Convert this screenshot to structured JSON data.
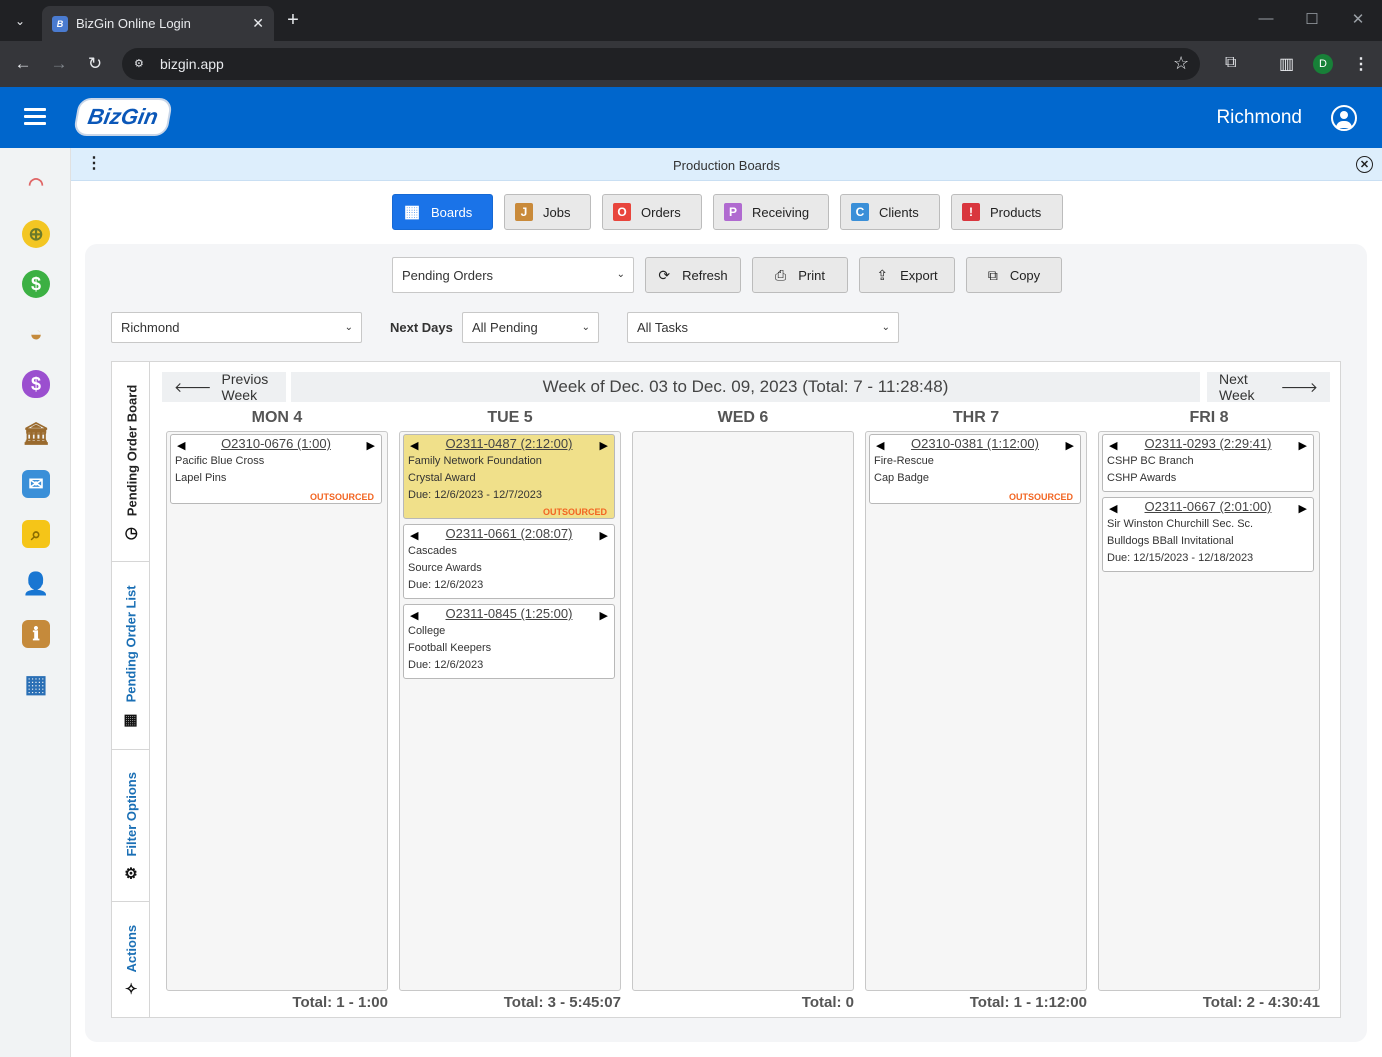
{
  "browser": {
    "tab_title": "BizGin Online Login",
    "favicon_label": "B",
    "tab_close": "✕",
    "new_tab": "+",
    "url": "bizgin.app",
    "profile_initial": "D"
  },
  "app": {
    "logo_text": "BizGin",
    "user_name": "Richmond",
    "banner_title": "Production Boards"
  },
  "sidebar_icons": [
    "speedometer-icon",
    "globe-icon",
    "dollar-icon",
    "hardhat-icon",
    "money-bag-icon",
    "bank-icon",
    "mail-icon",
    "folder-icon",
    "person-icon",
    "box-icon",
    "table-icon"
  ],
  "nav": [
    {
      "label": "Boards",
      "letter": "▦",
      "color": "#1a73e8"
    },
    {
      "label": "Jobs",
      "letter": "J",
      "color": "#c98a3a"
    },
    {
      "label": "Orders",
      "letter": "O",
      "color": "#e8453c"
    },
    {
      "label": "Receiving",
      "letter": "P",
      "color": "#b06ad0"
    },
    {
      "label": "Clients",
      "letter": "C",
      "color": "#3a8fd8"
    },
    {
      "label": "Products",
      "letter": "!",
      "color": "#d9363e"
    }
  ],
  "toolbar": {
    "view_select": "Pending Orders",
    "refresh": "Refresh",
    "print": "Print",
    "export": "Export",
    "copy": "Copy"
  },
  "filters": {
    "location": "Richmond",
    "next_days_label": "Next Days",
    "next_days": "All Pending",
    "tasks": "All Tasks"
  },
  "vtabs": {
    "board": "Pending Order Board",
    "list": "Pending Order List",
    "filter": "Filter Options",
    "actions": "Actions"
  },
  "week": {
    "prev": "Previos Week",
    "next": "Next Week",
    "title": "Week of Dec. 03 to Dec. 09, 2023 (Total: 7 - 11:28:48)"
  },
  "days": [
    {
      "header": "MON 4",
      "total": "Total: 1 - 1:00",
      "cards": [
        {
          "title": "O2310-0676 (1:00)",
          "lines": [
            "Pacific Blue Cross",
            "Lapel Pins"
          ],
          "status": "OUTSOURCED",
          "highlight": false
        }
      ]
    },
    {
      "header": "TUE 5",
      "total": "Total: 3 - 5:45:07",
      "cards": [
        {
          "title": "O2311-0487 (2:12:00)",
          "lines": [
            "Family Network Foundation",
            "Crystal Award",
            "Due: 12/6/2023 - 12/7/2023"
          ],
          "status": "OUTSOURCED",
          "highlight": true
        },
        {
          "title": "O2311-0661 (2:08:07)",
          "lines": [
            "Cascades",
            "Source Awards",
            "Due: 12/6/2023"
          ],
          "status": "",
          "highlight": false
        },
        {
          "title": "O2311-0845 (1:25:00)",
          "lines": [
            "College",
            "Football Keepers",
            "Due: 12/6/2023"
          ],
          "status": "",
          "highlight": false
        }
      ]
    },
    {
      "header": "WED 6",
      "total": "Total: 0",
      "cards": []
    },
    {
      "header": "THR 7",
      "total": "Total: 1 - 1:12:00",
      "cards": [
        {
          "title": "O2310-0381 (1:12:00)",
          "lines": [
            "Fire-Rescue",
            "Cap Badge"
          ],
          "status": "OUTSOURCED",
          "highlight": false
        }
      ]
    },
    {
      "header": "FRI 8",
      "total": "Total: 2 - 4:30:41",
      "cards": [
        {
          "title": "O2311-0293 (2:29:41)",
          "lines": [
            "CSHP BC Branch",
            "CSHP Awards"
          ],
          "status": "",
          "highlight": false
        },
        {
          "title": "O2311-0667 (2:01:00)",
          "lines": [
            "Sir Winston Churchill Sec. Sc.",
            "Bulldogs BBall Invitational",
            "Due: 12/15/2023 - 12/18/2023"
          ],
          "status": "",
          "highlight": false
        }
      ]
    }
  ]
}
